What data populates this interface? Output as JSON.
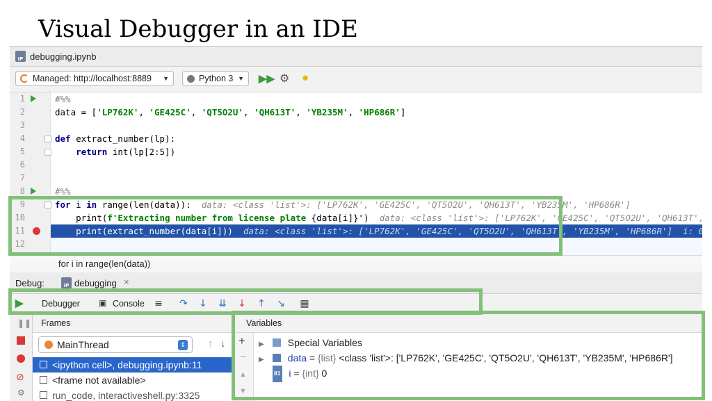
{
  "slide_title": "Visual Debugger in an IDE",
  "tab": {
    "icon_text": "IP",
    "filename": "debugging.ipynb"
  },
  "toolbar": {
    "server_label": "Managed: http://localhost:8889",
    "kernel_label": "Python 3"
  },
  "code_lines": [
    {
      "num": "1"
    },
    {
      "num": "2"
    },
    {
      "num": "3"
    },
    {
      "num": "4"
    },
    {
      "num": "5"
    },
    {
      "num": "6"
    },
    {
      "num": "7"
    },
    {
      "num": "8"
    },
    {
      "num": "9"
    },
    {
      "num": "10"
    },
    {
      "num": "11"
    },
    {
      "num": "12"
    }
  ],
  "code": {
    "cell_marker": "#%%",
    "l2_prefix": "data = [",
    "plates": [
      "'LP762K'",
      "'GE425C'",
      "'QT5O2U'",
      "'QH613T'",
      "'YB235M'",
      "'HP686R'"
    ],
    "l2_suffix": "]",
    "l4_kw": "def",
    "l4_rest": " extract_number(lp):",
    "l5_kw": "return",
    "l5_rest": " int(lp[2:5])",
    "l9_kw1": "for",
    "l9_mid1": " i ",
    "l9_kw2": "in",
    "l9_rest": " range(len(data)):",
    "l9_hint": "data: <class 'list'>: ['LP762K', 'GE425C', 'QT5O2U', 'QH613T', 'YB235M', 'HP686R']",
    "l10_pre": "print(",
    "l10_str": "f'Extracting number from license plate ",
    "l10_expr": "{data[i]}",
    "l10_str2": "'",
    "l10_post": ")",
    "l10_hint": "data: <class 'list'>: ['LP762K', 'GE425C', 'QT5O2U', 'QH613T',",
    "l11_code": "print(extract_number(data[i]))",
    "l11_hint": "data: <class 'list'>: ['LP762K', 'GE425C', 'QT5O2U', 'QH613T', 'YB235M', 'HP686R']",
    "l11_hint2": "i: 0"
  },
  "breadcrumb": "for i in range(len(data))",
  "debug": {
    "label": "Debug:",
    "session": "debugging"
  },
  "debug_tabs": {
    "debugger": "Debugger",
    "console": "Console"
  },
  "frames": {
    "header": "Frames",
    "thread": "MainThread",
    "rows": [
      "<ipython cell>, debugging.ipynb:11",
      "<frame not available>",
      "run_code, interactiveshell.py:3325"
    ]
  },
  "variables": {
    "header": "Variables",
    "special": "Special Variables",
    "data_name": "data",
    "data_eq": " = ",
    "data_type": "{list}",
    "data_value": " <class 'list'>: ['LP762K', 'GE425C', 'QT5O2U', 'QH613T', 'YB235M', 'HP686R']",
    "i_badge": "01",
    "i_name": "i",
    "i_eq": " = ",
    "i_type": "{int}",
    "i_value": " 0"
  },
  "colors": {
    "highlight_box": "#82c07a",
    "selection": "#2253a8",
    "breakpoint": "#d9383a",
    "run_green": "#3c9b3c",
    "step_blue": "#2f6fc2"
  }
}
